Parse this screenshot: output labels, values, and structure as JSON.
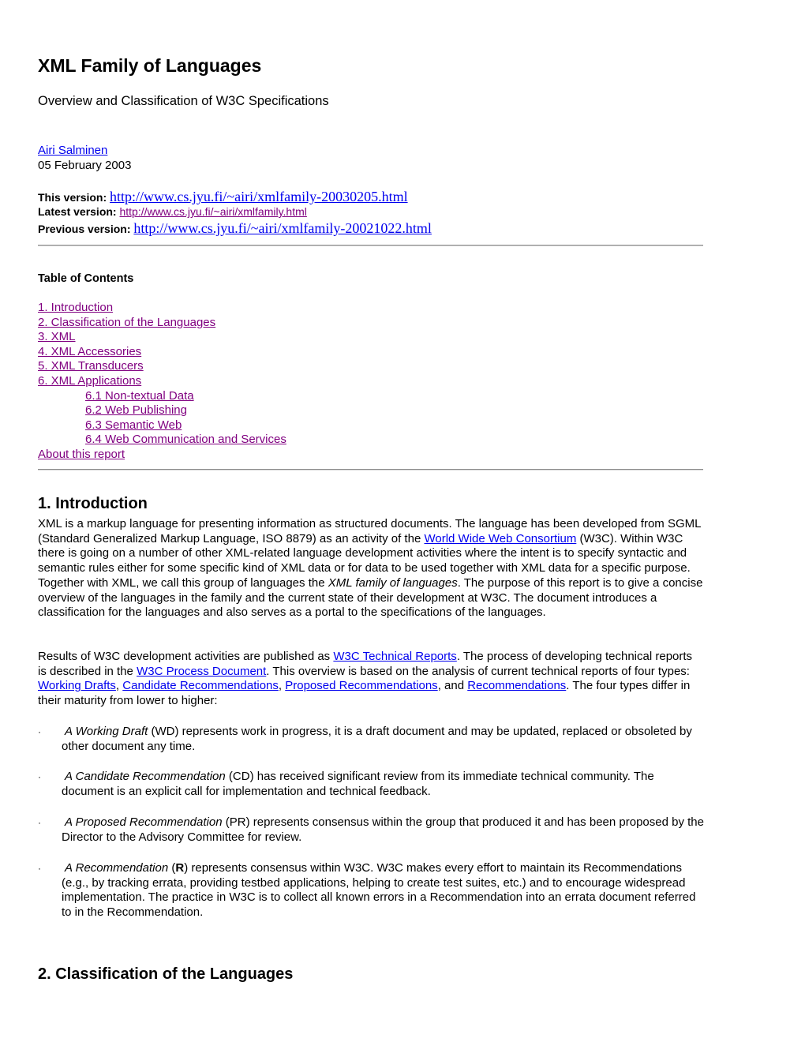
{
  "header": {
    "title": "XML Family of Languages",
    "subtitle": "Overview and Classification of W3C Specifications",
    "author": "Airi Salminen",
    "date": "05 February 2003"
  },
  "versions": [
    {
      "label": "This version:",
      "url": "http://www.cs.jyu.fi/~airi/xmlfamily-20030205.html"
    },
    {
      "label": "Latest version:",
      "url": "http://www.cs.jyu.fi/~airi/xmlfamily.html"
    },
    {
      "label": "Previous version:",
      "url": "http://www.cs.jyu.fi/~airi/xmlfamily-20021022.html"
    }
  ],
  "toc": {
    "title": "Table of Contents",
    "items": [
      {
        "label": "1. Introduction",
        "level": 1
      },
      {
        "label": "2. Classification of the Languages",
        "level": 1
      },
      {
        "label": "3. XML",
        "level": 1
      },
      {
        "label": "4. XML Accessories",
        "level": 1
      },
      {
        "label": "5. XML Transducers",
        "level": 1
      },
      {
        "label": "6. XML Applications",
        "level": 1
      },
      {
        "label": "6.1 Non-textual Data",
        "level": 2
      },
      {
        "label": "6.2 Web Publishing",
        "level": 2
      },
      {
        "label": "6.3 Semantic Web",
        "level": 2
      },
      {
        "label": "6.4 Web Communication and Services",
        "level": 2
      },
      {
        "label": "About this report",
        "level": 1
      }
    ]
  },
  "intro": {
    "heading": "1. Introduction",
    "p1": {
      "t1": "XML is a markup language for presenting information as structured documents. The language has been developed from SGML (Standard Generalized Markup Language, ISO 8879) as an activity of the ",
      "link1": "World Wide Web Consortium",
      "t2": " (W3C). Within W3C there is going on a number of other XML-related language development activities where the intent is to specify syntactic and semantic rules either for some specific kind of XML data or for data to be used together with XML data for a specific purpose. Together with XML, we call this group of languages the ",
      "em": "XML family of languages",
      "t3": ". The purpose of this report is to give a concise overview of the languages in the family and the current state of their development at W3C. The document introduces a classification for the languages and also serves as a portal to the specifications of the languages."
    },
    "p2": {
      "t1": "Results of W3C development activities are published as ",
      "link1": "W3C Technical Reports",
      "t2": ". The process of developing technical reports is described in the ",
      "link2": "W3C Process Document",
      "t3": ". This overview is based on the analysis of current technical reports of four types: ",
      "link3": "Working Drafts",
      "sep1": ", ",
      "link4": "Candidate Recommendations",
      "sep2": ", ",
      "link5": "Proposed Recommendations",
      "sep3": ", and ",
      "link6": "Recommendations",
      "t4": ". The four types differ in their maturity from lower to higher:"
    },
    "bullets": [
      {
        "em": "A Working Draft",
        "abbr": "WD",
        "rest": " represents work in progress, it is a draft document and may be updated, replaced or obsoleted by other document any time."
      },
      {
        "em": "A Candidate Recommendation",
        "abbr": "CD",
        "rest": " has received significant review from its immediate technical community. The document is an explicit call for implementation and technical feedback."
      },
      {
        "em": "A Proposed Recommendation",
        "abbr": "PR",
        "rest": " represents consensus within the group that produced it and has been proposed by the Director to the Advisory Committee for review."
      },
      {
        "em": "A Recommendation",
        "abbr": "R",
        "rest": " represents consensus within W3C. W3C makes every effort to maintain its Recommendations (e.g., by tracking errata, providing testbed applications, helping to create test suites, etc.) and to encourage widespread implementation. The practice in W3C is to collect all known errors in a Recommendation into an errata document referred to in the Recommendation."
      }
    ],
    "bullet_char": "·"
  },
  "section2": {
    "heading": "2. Classification of the Languages"
  },
  "colors": {
    "link": "#0000ee",
    "visited_link": "#800080",
    "rule": "#8a8a8a"
  }
}
